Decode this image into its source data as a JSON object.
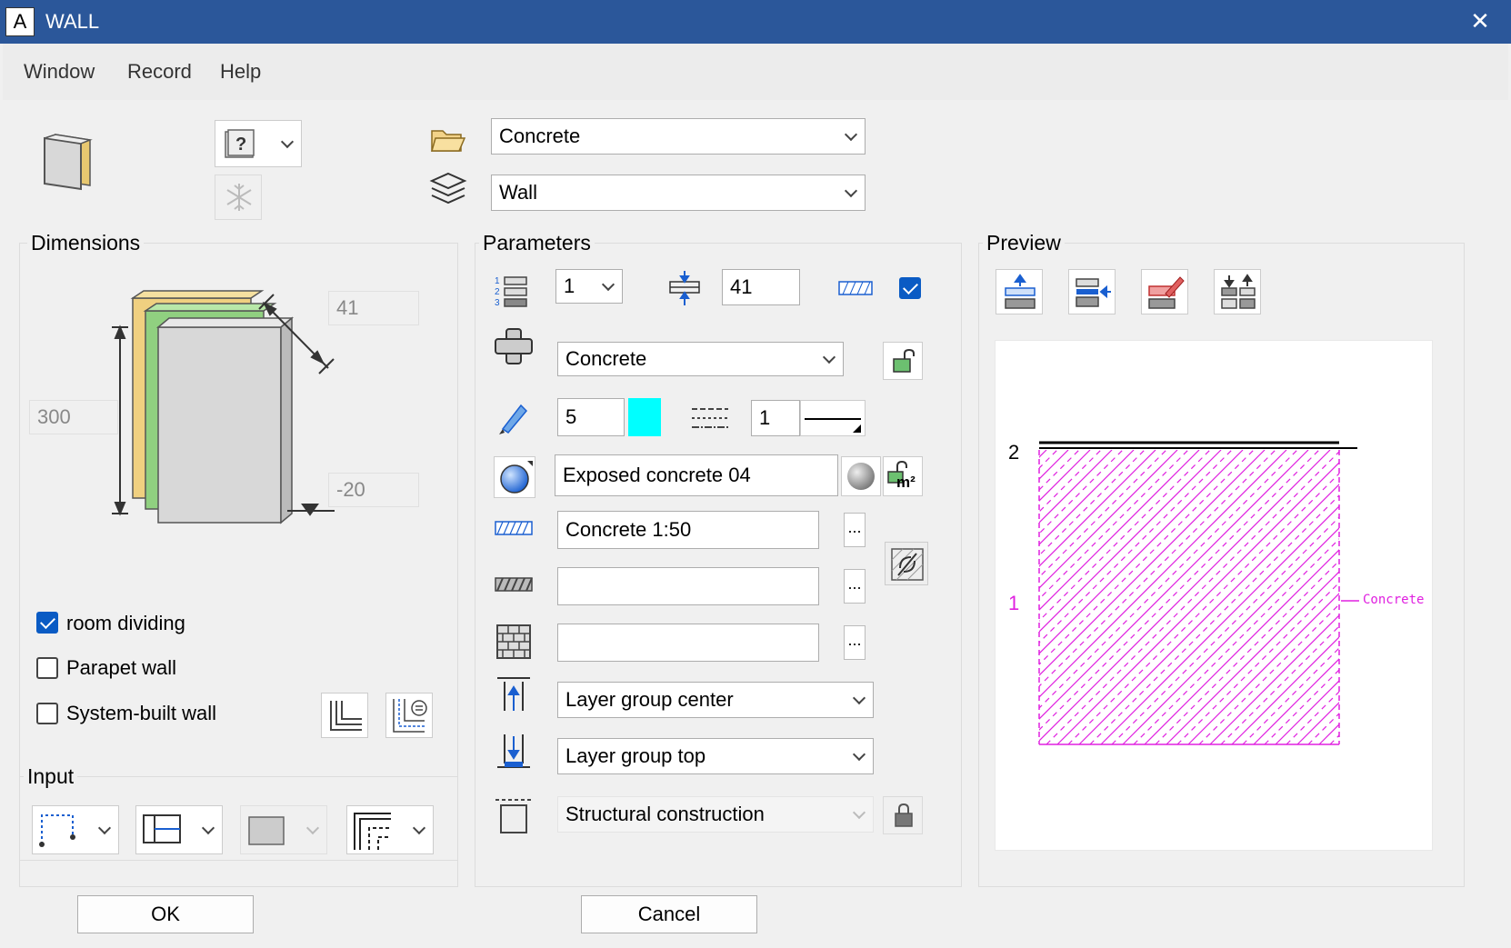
{
  "window": {
    "title": "WALL",
    "app_icon_letter": "A",
    "close_symbol": "✕"
  },
  "menu": [
    {
      "label": "Window"
    },
    {
      "label": "Record"
    },
    {
      "label": "Help"
    }
  ],
  "top": {
    "material_folder_value": "Concrete",
    "layer_value": "Wall"
  },
  "dimensions": {
    "label": "Dimensions",
    "thickness": "41",
    "height": "300",
    "offset": "-20"
  },
  "checkboxes": {
    "room_dividing": {
      "label": "room dividing",
      "checked": true
    },
    "parapet_wall": {
      "label": "Parapet wall",
      "checked": false
    },
    "system_built_wall": {
      "label": "System-built wall",
      "checked": false
    }
  },
  "input": {
    "label": "Input"
  },
  "parameters": {
    "label": "Parameters",
    "layer_number": "1",
    "thickness": "41",
    "material": "Concrete",
    "pen": "5",
    "line_type": "1",
    "surface": "Exposed concrete 04",
    "hatching": "Concrete 1:50",
    "pattern": "",
    "filling": "",
    "anchor_center": "Layer group center",
    "anchor_top": "Layer group top",
    "construction": "Structural construction",
    "ellipsis": "...",
    "m2": "m²"
  },
  "preview": {
    "label": "Preview",
    "layer_top_label": "2",
    "layer_label": "1",
    "material_tag": "Concrete"
  },
  "colors": {
    "accent": "#0a5bc4",
    "title_bar": "#2b579a",
    "pen_color": "#00ffff",
    "hatch": "#e020e0"
  },
  "buttons": {
    "ok": "OK",
    "cancel": "Cancel"
  }
}
